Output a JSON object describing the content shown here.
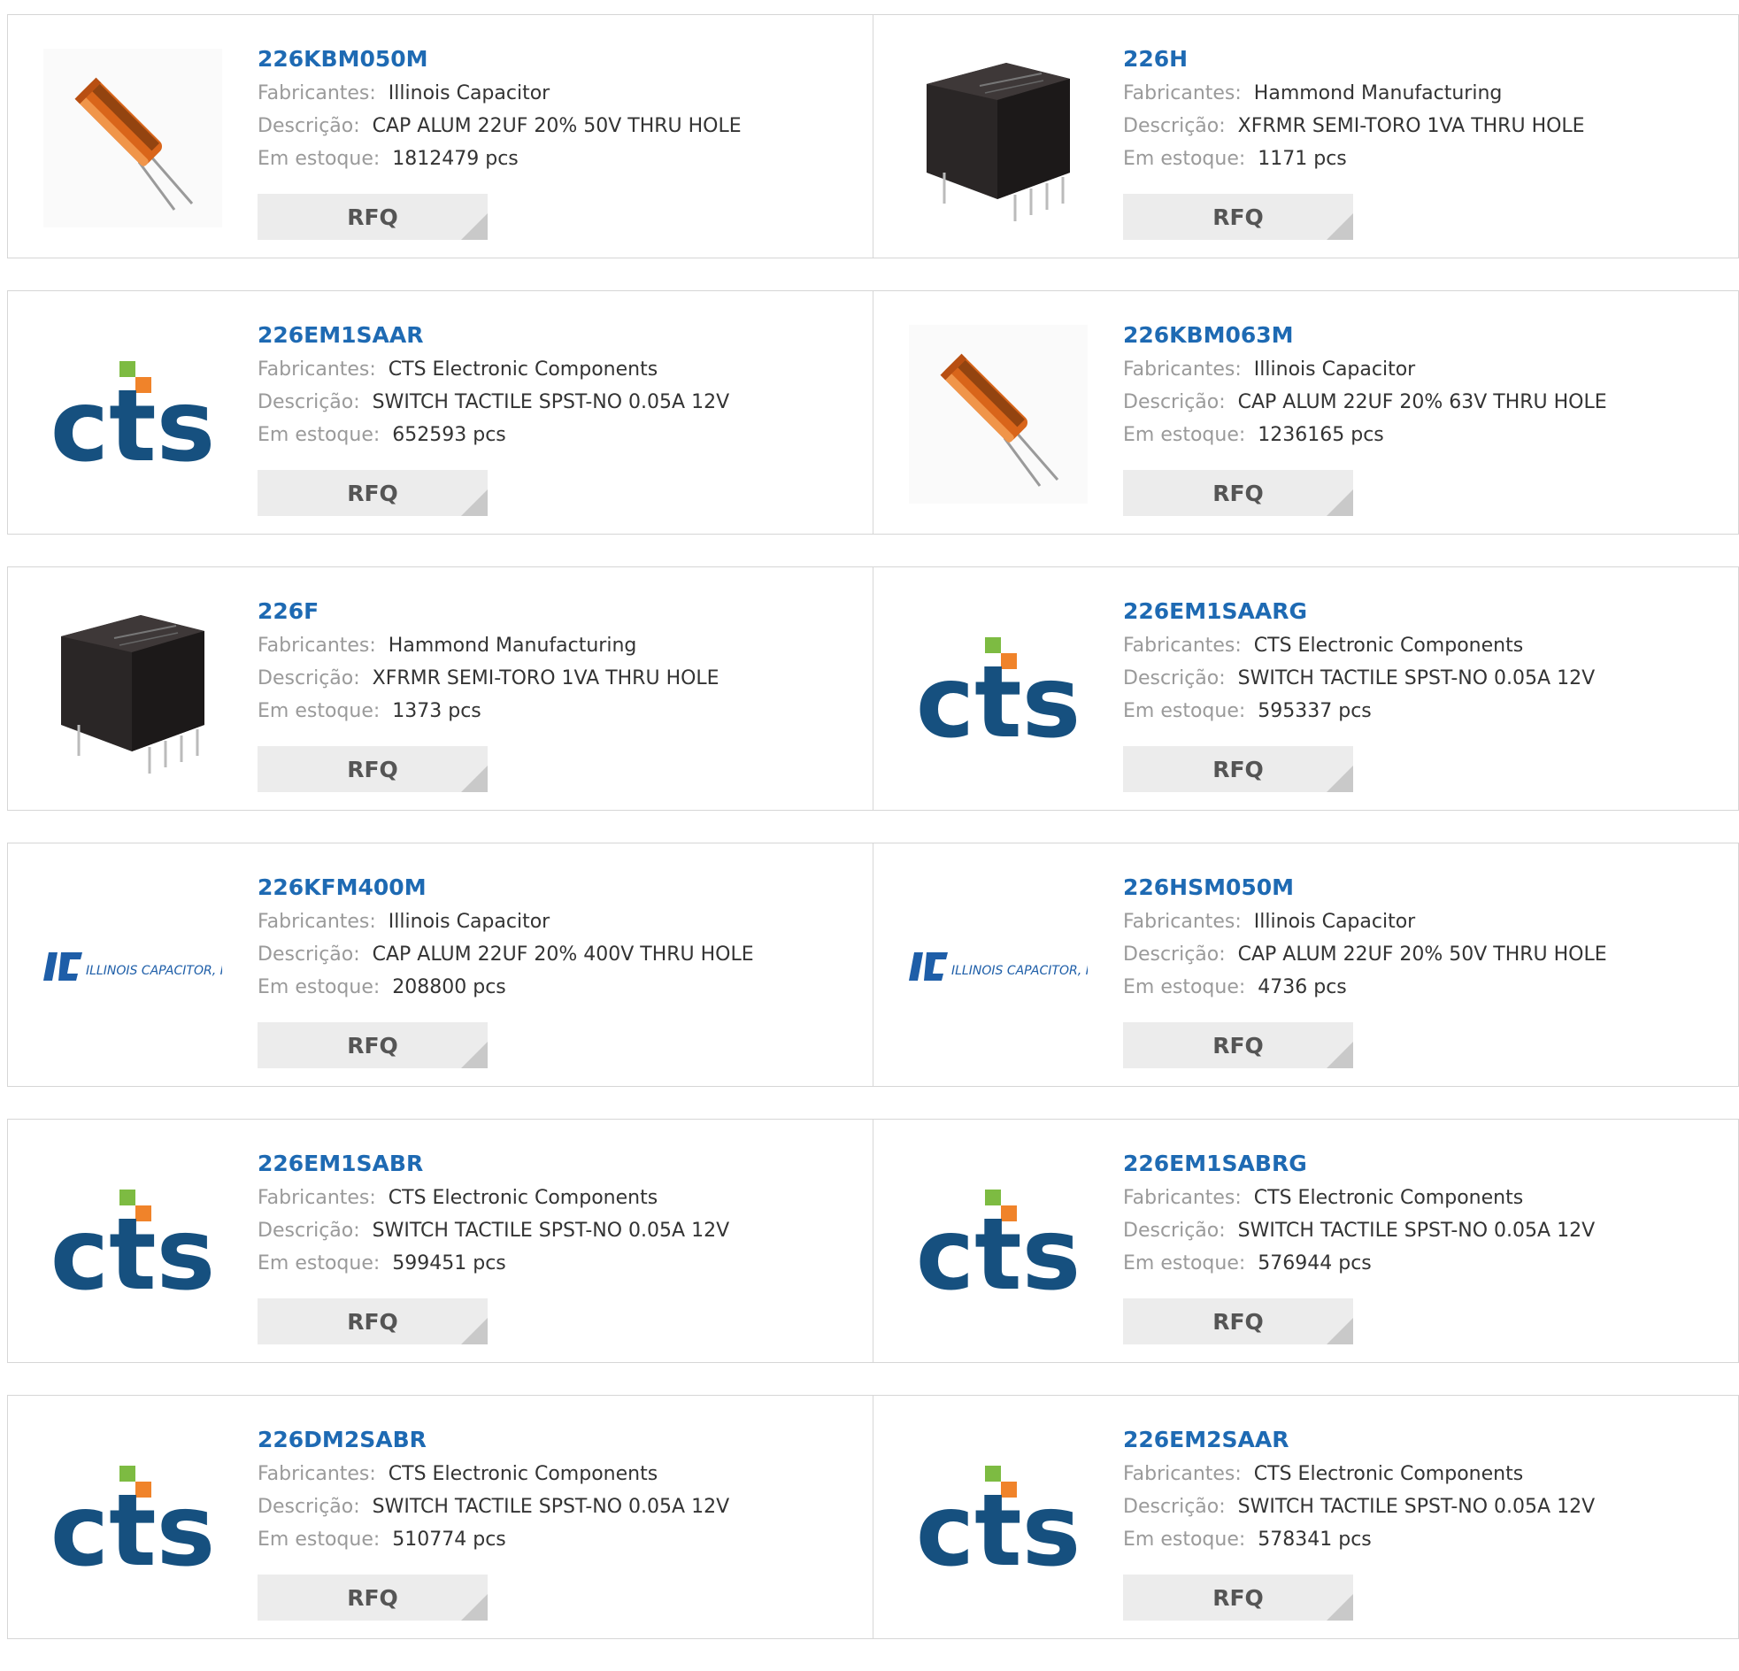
{
  "labels": {
    "manufacturer": "Fabricantes:",
    "description": "Descrição:",
    "stock": "Em estoque:",
    "rfq": "RFQ"
  },
  "colors": {
    "part_link": "#1e6ab3",
    "label_gray": "#9a9a9a",
    "rfq_bg": "#ececec",
    "cts_blue": "#16507f",
    "cts_green": "#7dbb42",
    "cts_orange": "#f0832a"
  },
  "products": [
    {
      "part": "226KBM050M",
      "manufacturer": "Illinois Capacitor",
      "description": "CAP ALUM 22UF 20% 50V THRU HOLE",
      "stock": "1812479 pcs",
      "image": "capacitor-photo"
    },
    {
      "part": "226H",
      "manufacturer": "Hammond Manufacturing",
      "description": "XFRMR SEMI-TORO 1VA THRU HOLE",
      "stock": "1171 pcs",
      "image": "transformer-photo"
    },
    {
      "part": "226EM1SAAR",
      "manufacturer": "CTS Electronic Components",
      "description": "SWITCH TACTILE SPST-NO 0.05A 12V",
      "stock": "652593 pcs",
      "image": "cts-logo"
    },
    {
      "part": "226KBM063M",
      "manufacturer": "Illinois Capacitor",
      "description": "CAP ALUM 22UF 20% 63V THRU HOLE",
      "stock": "1236165 pcs",
      "image": "capacitor-photo"
    },
    {
      "part": "226F",
      "manufacturer": "Hammond Manufacturing",
      "description": "XFRMR SEMI-TORO 1VA THRU HOLE",
      "stock": "1373 pcs",
      "image": "transformer-photo"
    },
    {
      "part": "226EM1SAARG",
      "manufacturer": "CTS Electronic Components",
      "description": "SWITCH TACTILE SPST-NO 0.05A 12V",
      "stock": "595337 pcs",
      "image": "cts-logo"
    },
    {
      "part": "226KFM400M",
      "manufacturer": "Illinois Capacitor",
      "description": "CAP ALUM 22UF 20% 400V THRU HOLE",
      "stock": "208800 pcs",
      "image": "illinois-capacitor-logo"
    },
    {
      "part": "226HSM050M",
      "manufacturer": "Illinois Capacitor",
      "description": "CAP ALUM 22UF 20% 50V THRU HOLE",
      "stock": "4736 pcs",
      "image": "illinois-capacitor-logo"
    },
    {
      "part": "226EM1SABR",
      "manufacturer": "CTS Electronic Components",
      "description": "SWITCH TACTILE SPST-NO 0.05A 12V",
      "stock": "599451 pcs",
      "image": "cts-logo"
    },
    {
      "part": "226EM1SABRG",
      "manufacturer": "CTS Electronic Components",
      "description": "SWITCH TACTILE SPST-NO 0.05A 12V",
      "stock": "576944 pcs",
      "image": "cts-logo"
    },
    {
      "part": "226DM2SABR",
      "manufacturer": "CTS Electronic Components",
      "description": "SWITCH TACTILE SPST-NO 0.05A 12V",
      "stock": "510774 pcs",
      "image": "cts-logo"
    },
    {
      "part": "226EM2SAAR",
      "manufacturer": "CTS Electronic Components",
      "description": "SWITCH TACTILE SPST-NO 0.05A 12V",
      "stock": "578341 pcs",
      "image": "cts-logo"
    }
  ],
  "logo_text": {
    "cts": "cts",
    "illinois": "ILLINOIS CAPACITOR, INC."
  }
}
